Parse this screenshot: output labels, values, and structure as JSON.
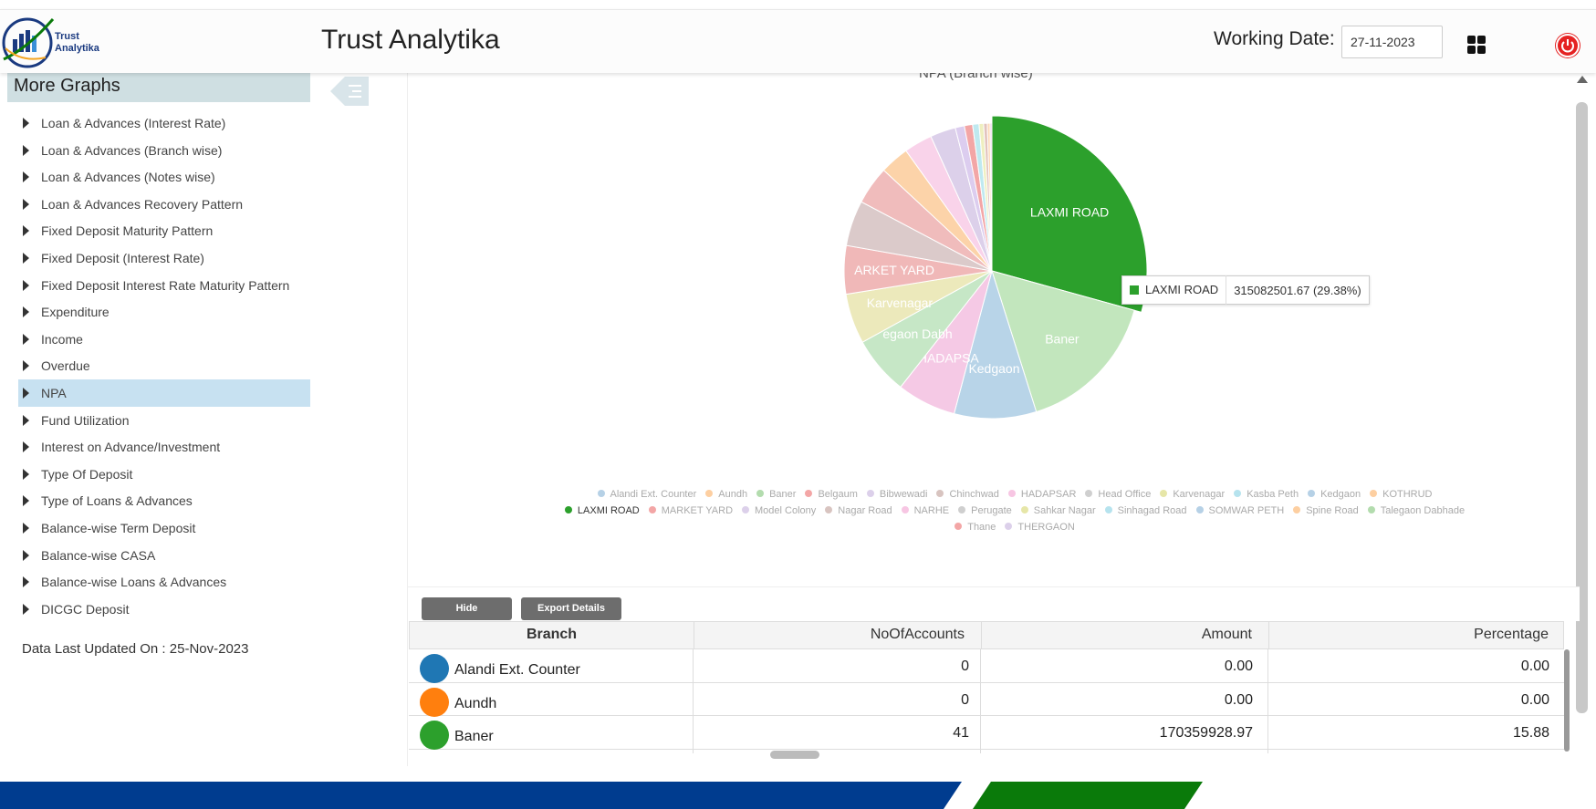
{
  "header": {
    "logo_line1": "Trust",
    "logo_line2": "Analytika",
    "app_title": "Trust Analytika",
    "working_date_label": "Working Date:",
    "working_date_value": "27-11-2023"
  },
  "sidebar": {
    "title": "More Graphs",
    "items": [
      {
        "label": "Loan & Advances (Interest Rate)"
      },
      {
        "label": "Loan & Advances (Branch wise)"
      },
      {
        "label": "Loan & Advances (Notes wise)"
      },
      {
        "label": "Loan & Advances Recovery Pattern"
      },
      {
        "label": "Fixed Deposit Maturity Pattern"
      },
      {
        "label": "Fixed Deposit (Interest Rate)"
      },
      {
        "label": "Fixed Deposit Interest Rate Maturity Pattern"
      },
      {
        "label": "Expenditure"
      },
      {
        "label": "Income"
      },
      {
        "label": "Overdue"
      },
      {
        "label": "NPA"
      },
      {
        "label": "Fund Utilization"
      },
      {
        "label": "Interest on Advance/Investment"
      },
      {
        "label": "Type Of Deposit"
      },
      {
        "label": "Type of Loans & Advances"
      },
      {
        "label": "Balance-wise Term Deposit"
      },
      {
        "label": "Balance-wise CASA"
      },
      {
        "label": "Balance-wise Loans & Advances"
      },
      {
        "label": "DICGC Deposit"
      }
    ],
    "active_item": "NPA",
    "last_updated": "Data Last Updated On : 25-Nov-2023"
  },
  "chart_data": {
    "type": "pie",
    "title": "NPA (Branch wise)",
    "slices": [
      {
        "name": "LAXMI ROAD",
        "percent": 29.38,
        "color": "#2ca02c",
        "label": "LAXMI ROAD"
      },
      {
        "name": "Baner",
        "percent": 15.88,
        "color": "#c2e6bd",
        "label": "Baner"
      },
      {
        "name": "Kedgaon",
        "percent": 9.0,
        "color": "#b8d4e8",
        "label": "Kedgaon"
      },
      {
        "name": "HADAPSAR",
        "percent": 6.5,
        "color": "#f5c9e5",
        "label": "HADAPSA"
      },
      {
        "name": "Talegaon Dabhade",
        "percent": 6.4,
        "color": "#c6e7c6",
        "label": "egaon Dabh"
      },
      {
        "name": "Karvenagar",
        "percent": 5.5,
        "color": "#ece9bb",
        "label": "Karvenagar"
      },
      {
        "name": "MARKET YARD",
        "percent": 5.3,
        "color": "#f0b8b8",
        "label": "ARKET YARD"
      },
      {
        "name": "Chinchwad",
        "percent": 5.0,
        "color": "#dbcaca",
        "label": ""
      },
      {
        "name": "Thane",
        "percent": 4.2,
        "color": "#f0bcbc",
        "label": ""
      },
      {
        "name": "Spine Road",
        "percent": 3.2,
        "color": "#fcd3a9",
        "label": ""
      },
      {
        "name": "NARHE",
        "percent": 3.1,
        "color": "#f9d3ea",
        "label": ""
      },
      {
        "name": "Bibwewadi",
        "percent": 2.8,
        "color": "#dcd0ea",
        "label": ""
      },
      {
        "name": "Model Colony",
        "percent": 1.0,
        "color": "#dccdef",
        "label": ""
      },
      {
        "name": "Belgaum",
        "percent": 0.9,
        "color": "#f3a6a6",
        "label": ""
      },
      {
        "name": "Sinhagad Road",
        "percent": 0.7,
        "color": "#bfe9f0",
        "label": ""
      },
      {
        "name": "Sahkar Nagar",
        "percent": 0.5,
        "color": "#efefc0",
        "label": ""
      },
      {
        "name": "Nagar Road",
        "percent": 0.4,
        "color": "#e2c3bd",
        "label": ""
      },
      {
        "name": "KOTHRUD",
        "percent": 0.3,
        "color": "#fed8b6",
        "label": ""
      },
      {
        "name": "THERGAON",
        "percent": 0.2,
        "color": "#e5cfe8",
        "label": ""
      },
      {
        "name": "Alandi Ext. Counter",
        "percent": 0.0,
        "color": "#b6d1e6",
        "label": ""
      },
      {
        "name": "Aundh",
        "percent": 0.0,
        "color": "#fdcfa1",
        "label": ""
      }
    ],
    "legend": [
      {
        "name": "Alandi Ext. Counter",
        "color": "#b6d1e6"
      },
      {
        "name": "Aundh",
        "color": "#fdcfa1"
      },
      {
        "name": "Baner",
        "color": "#b3dcae"
      },
      {
        "name": "Belgaum",
        "color": "#f3a6a6"
      },
      {
        "name": "Bibwewadi",
        "color": "#dcd0ea"
      },
      {
        "name": "Chinchwad",
        "color": "#d8c4c0"
      },
      {
        "name": "HADAPSAR",
        "color": "#f7c6e3"
      },
      {
        "name": "Head Office",
        "color": "#cfcfcf"
      },
      {
        "name": "Karvenagar",
        "color": "#e6e6a8"
      },
      {
        "name": "Kasba Peth",
        "color": "#b6e3ee"
      },
      {
        "name": "Kedgaon",
        "color": "#b6d1e6"
      },
      {
        "name": "KOTHRUD",
        "color": "#fdcfa1"
      },
      {
        "name": "LAXMI ROAD",
        "color": "#2ca02c",
        "active": true
      },
      {
        "name": "MARKET YARD",
        "color": "#f3a6a6"
      },
      {
        "name": "Model Colony",
        "color": "#dcd0ea"
      },
      {
        "name": "Nagar Road",
        "color": "#d8c4c0"
      },
      {
        "name": "NARHE",
        "color": "#f7c6e3"
      },
      {
        "name": "Perugate",
        "color": "#cfcfcf"
      },
      {
        "name": "Sahkar Nagar",
        "color": "#e6e6a8"
      },
      {
        "name": "Sinhagad Road",
        "color": "#b6e3ee"
      },
      {
        "name": "SOMWAR PETH",
        "color": "#b6d1e6"
      },
      {
        "name": "Spine Road",
        "color": "#fdcfa1"
      },
      {
        "name": "Talegaon Dabhade",
        "color": "#b3dcae"
      },
      {
        "name": "Thane",
        "color": "#f3a6a6"
      },
      {
        "name": "THERGAON",
        "color": "#dcd0ea"
      }
    ],
    "tooltip": {
      "name": "LAXMI ROAD",
      "value": "315082501.67 (29.38%)"
    }
  },
  "table": {
    "hide_label": "Hide",
    "export_label": "Export Details",
    "headers": [
      "Branch",
      "NoOfAccounts",
      "Amount",
      "Percentage"
    ],
    "rows": [
      {
        "branch": "Alandi Ext. Counter",
        "accounts": "0",
        "amount": "0.00",
        "percentage": "0.00",
        "color": "#1f77b4"
      },
      {
        "branch": "Aundh",
        "accounts": "0",
        "amount": "0.00",
        "percentage": "0.00",
        "color": "#ff7f0e"
      },
      {
        "branch": "Baner",
        "accounts": "41",
        "amount": "170359928.97",
        "percentage": "15.88",
        "color": "#2ca02c"
      }
    ]
  },
  "colors": {
    "brand_blue": "#003c8f",
    "brand_green": "#0a7a0a",
    "active_item_bg": "#c7e1f1",
    "sidebar_title_bg": "#cfdfe2"
  }
}
